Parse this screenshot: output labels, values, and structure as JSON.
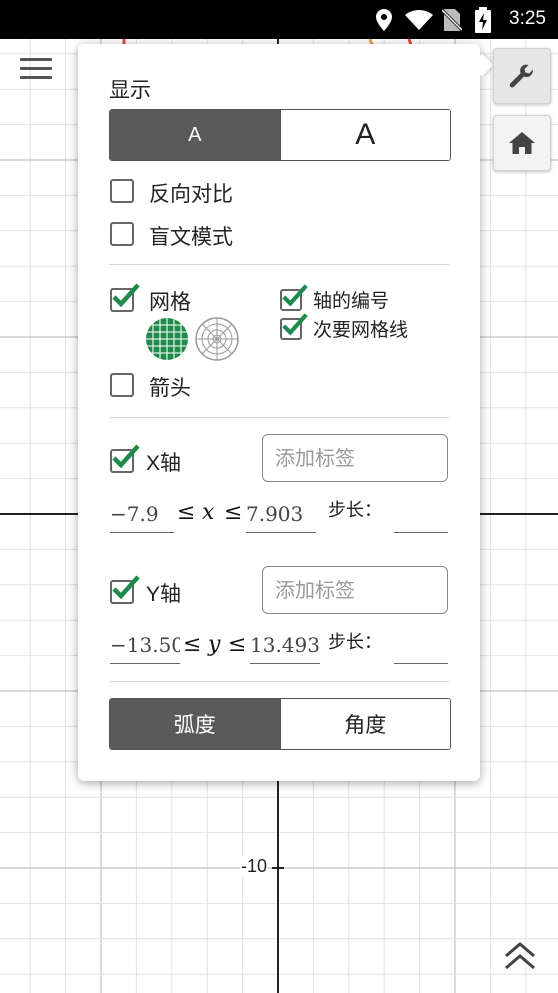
{
  "status_bar": {
    "time": "3:25",
    "icons": [
      "location-icon",
      "wifi-icon",
      "no-sim-icon",
      "battery-charging-icon"
    ]
  },
  "graph": {
    "tick_label": "-10"
  },
  "toolbar": {
    "menu_icon": "hamburger-icon",
    "wrench_icon": "wrench-icon",
    "home_icon": "home-icon",
    "collapse_icon": "double-chevron-up-icon"
  },
  "settings": {
    "display_title": "显示",
    "font_size_options": [
      "A",
      "A"
    ],
    "font_size_selected": 0,
    "reverse_contrast_label": "反向对比",
    "reverse_contrast_checked": false,
    "braille_mode_label": "盲文模式",
    "braille_mode_checked": false,
    "grid_label": "网格",
    "grid_checked": true,
    "axis_numbers_label": "轴的编号",
    "axis_numbers_checked": true,
    "minor_grid_label": "次要网格线",
    "minor_grid_checked": true,
    "grid_types": [
      "rectangular-grid-icon",
      "polar-grid-icon"
    ],
    "arrows_label": "箭头",
    "arrows_checked": false,
    "x_axis": {
      "label": "X轴",
      "checked": true,
      "label_placeholder": "添加标签",
      "min": "−7.9",
      "max": "7.903",
      "var": "x",
      "le": "≤",
      "step_label": "步长："
    },
    "y_axis": {
      "label": "Y轴",
      "checked": true,
      "label_placeholder": "添加标签",
      "min": "−13.50",
      "max": "13.493",
      "var": "y",
      "le": "≤",
      "step_label": "步长："
    },
    "angle_units": [
      "弧度",
      "角度"
    ],
    "angle_selected": 0
  },
  "colors": {
    "check": "#1e8a4c",
    "selected_segment": "#5a5a5a",
    "grid_minor": "#e2e2e2",
    "grid_major": "#c2c2c2",
    "axis": "#222222",
    "curve_red": "#e0483a",
    "curve_orange": "#f0a040"
  }
}
